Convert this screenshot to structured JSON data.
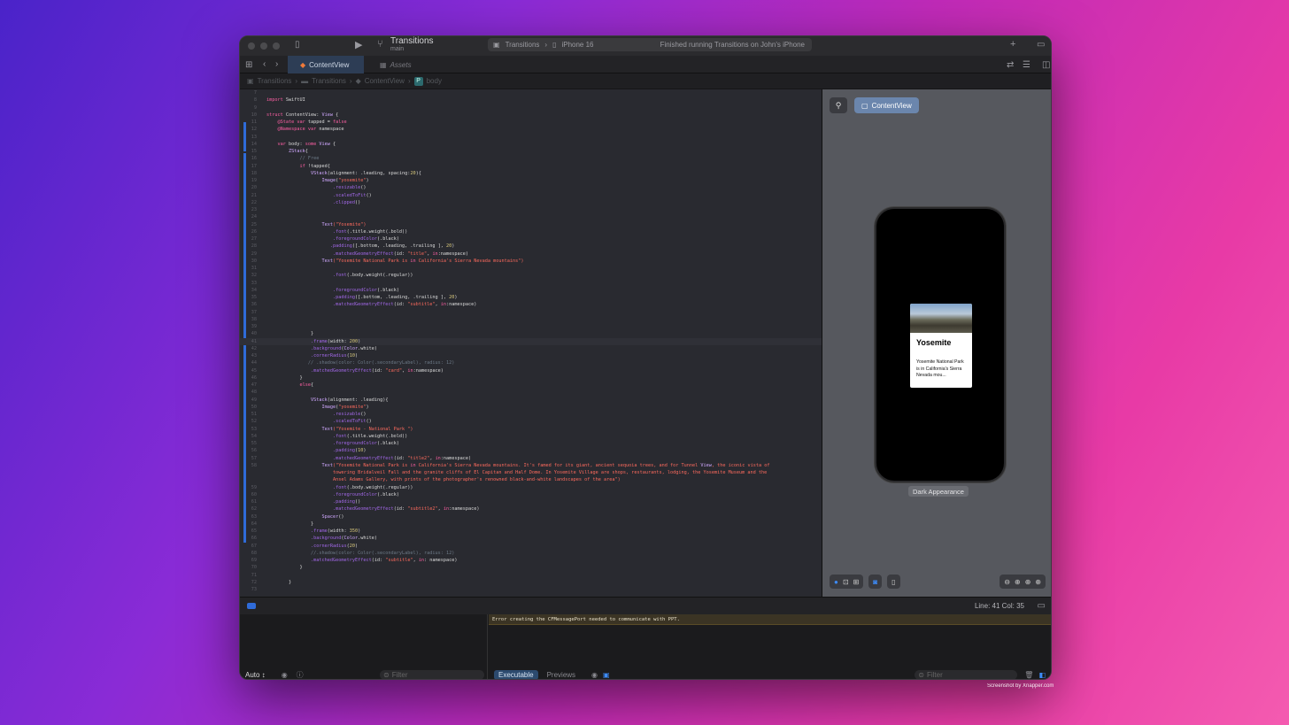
{
  "titlebar": {
    "project_name": "Transitions",
    "branch": "main",
    "scheme_target": "Transitions",
    "device": "iPhone 16",
    "status": "Finished running Transitions on John's iPhone",
    "icons": [
      "sidebar-icon",
      "play-icon",
      "branch-icon",
      "plus-icon",
      "inspector-icon"
    ]
  },
  "tabs": [
    {
      "label": "ContentView"
    },
    {
      "label": "Assets"
    }
  ],
  "breadcrumb": [
    "Transitions",
    "Transitions",
    "ContentView",
    "P",
    "body"
  ],
  "code_lines": [
    {
      "n": "7",
      "t": ""
    },
    {
      "n": "8",
      "t": "import SwiftUI"
    },
    {
      "n": "9",
      "t": ""
    },
    {
      "n": "10",
      "t": "struct ContentView: View {"
    },
    {
      "n": "11",
      "t": "    @State var tapped = false"
    },
    {
      "n": "12",
      "t": "    @Namespace var namespace"
    },
    {
      "n": "13",
      "t": ""
    },
    {
      "n": "14",
      "t": "    var body: some View {"
    },
    {
      "n": "15",
      "t": "        ZStack{"
    },
    {
      "n": "16",
      "t": "            // Free"
    },
    {
      "n": "17",
      "t": "            if !tapped{"
    },
    {
      "n": "18",
      "t": "                VStack(alignment: .leading, spacing:20){"
    },
    {
      "n": "19",
      "t": "                    Image(\"yosemite\")"
    },
    {
      "n": "20",
      "t": "                        .resizable()"
    },
    {
      "n": "21",
      "t": "                        .scaledToFit()"
    },
    {
      "n": "22",
      "t": "                        .clipped()"
    },
    {
      "n": "23",
      "t": ""
    },
    {
      "n": "24",
      "t": ""
    },
    {
      "n": "25",
      "t": "                    Text(\"Yosemite\")"
    },
    {
      "n": "26",
      "t": "                        .font(.title.weight(.bold))"
    },
    {
      "n": "27",
      "t": "                        .foregroundColor(.black)"
    },
    {
      "n": "28",
      "t": "                       .padding([.bottom, .leading, .trailing ], 20)"
    },
    {
      "n": "29",
      "t": "                        .matchedGeometryEffect(id: \"title\", in:namespace)"
    },
    {
      "n": "30",
      "t": "                    Text(\"Yosemite National Park is in California's Sierra Nevada mountains\")"
    },
    {
      "n": "31",
      "t": ""
    },
    {
      "n": "32",
      "t": "                        .font(.body.weight(.regular))"
    },
    {
      "n": "33",
      "t": ""
    },
    {
      "n": "34",
      "t": "                        .foregroundColor(.black)"
    },
    {
      "n": "35",
      "t": "                        .padding([.bottom, .leading, .trailing ], 20)"
    },
    {
      "n": "36",
      "t": "                        .matchedGeometryEffect(id: \"subtitle\", in:namespace)"
    },
    {
      "n": "37",
      "t": ""
    },
    {
      "n": "38",
      "t": ""
    },
    {
      "n": "39",
      "t": ""
    },
    {
      "n": "40",
      "t": "                }"
    },
    {
      "n": "41",
      "t": "                .frame(width: 200)"
    },
    {
      "n": "42",
      "t": "                .background(Color.white)"
    },
    {
      "n": "43",
      "t": "                .cornerRadius(10)"
    },
    {
      "n": "44",
      "t": "               // .shadow(color: Color(.secondaryLabel), radius: 12)"
    },
    {
      "n": "45",
      "t": "                .matchedGeometryEffect(id: \"card\", in:namespace)"
    },
    {
      "n": "46",
      "t": "            }"
    },
    {
      "n": "47",
      "t": "            else{"
    },
    {
      "n": "48",
      "t": ""
    },
    {
      "n": "49",
      "t": "                VStack(alignment: .leading){"
    },
    {
      "n": "50",
      "t": "                    Image(\"yosemite\")"
    },
    {
      "n": "51",
      "t": "                        .resizable()"
    },
    {
      "n": "52",
      "t": "                        .scaledToFit()"
    },
    {
      "n": "53",
      "t": "                    Text(\"Yosemite - National Park \")"
    },
    {
      "n": "54",
      "t": "                        .font(.title.weight(.bold))"
    },
    {
      "n": "55",
      "t": "                        .foregroundColor(.black)"
    },
    {
      "n": "56",
      "t": "                        .padding(10)"
    },
    {
      "n": "57",
      "t": "                        .matchedGeometryEffect(id: \"title2\", in:namespace)"
    },
    {
      "n": "58",
      "t": "                    Text(\"Yosemite National Park is in California's Sierra Nevada mountains. It's famed for its giant, ancient sequoia trees, and for Tunnel View, the iconic vista of"
    },
    {
      "n": "",
      "t": "                        towering Bridalveil Fall and the granite cliffs of El Capitan and Half Dome. In Yosemite Village are shops, restaurants, lodging, the Yosemite Museum and the"
    },
    {
      "n": "",
      "t": "                        Ansel Adams Gallery, with prints of the photographer's renowned black-and-white landscapes of the area\")"
    },
    {
      "n": "59",
      "t": "                        .font(.body.weight(.regular))"
    },
    {
      "n": "60",
      "t": "                        .foregroundColor(.black)"
    },
    {
      "n": "61",
      "t": "                        .padding()"
    },
    {
      "n": "62",
      "t": "                        .matchedGeometryEffect(id: \"subtitle2\", in:namespace)"
    },
    {
      "n": "63",
      "t": "                    Spacer()"
    },
    {
      "n": "64",
      "t": "                }"
    },
    {
      "n": "65",
      "t": "                .frame(width: 350)"
    },
    {
      "n": "66",
      "t": "                .background(Color.white)"
    },
    {
      "n": "67",
      "t": "                .cornerRadius(20)"
    },
    {
      "n": "68",
      "t": "                //.shadow(color: Color(.secondaryLabel), radius: 12)"
    },
    {
      "n": "69",
      "t": "                .matchedGeometryEffect(id: \"subtitle\", in: namespace)"
    },
    {
      "n": "70",
      "t": "            }"
    },
    {
      "n": "71",
      "t": ""
    },
    {
      "n": "72",
      "t": "        }"
    },
    {
      "n": "73",
      "t": ""
    }
  ],
  "current_line": "41",
  "preview": {
    "view_chip": "ContentView",
    "card_title": "Yosemite",
    "card_text": "Yosemite National Park is in California's Sierra Nevada mou...",
    "appearance": "Dark Appearance"
  },
  "status": {
    "line_col": "Line: 41  Col: 35"
  },
  "debug": {
    "error_message": "Error creating the CFMessagePort needed to communicate with PPT.",
    "auto_label": "Auto ↕",
    "filter_placeholder": "Filter",
    "tab_executable": "Executable",
    "tab_previews": "Previews"
  },
  "credit": "Screenshot by Xnapper.com",
  "colors": {
    "accent": "#2f6bd8",
    "editor_bg": "#292a30",
    "preview_bg": "#56585e"
  }
}
